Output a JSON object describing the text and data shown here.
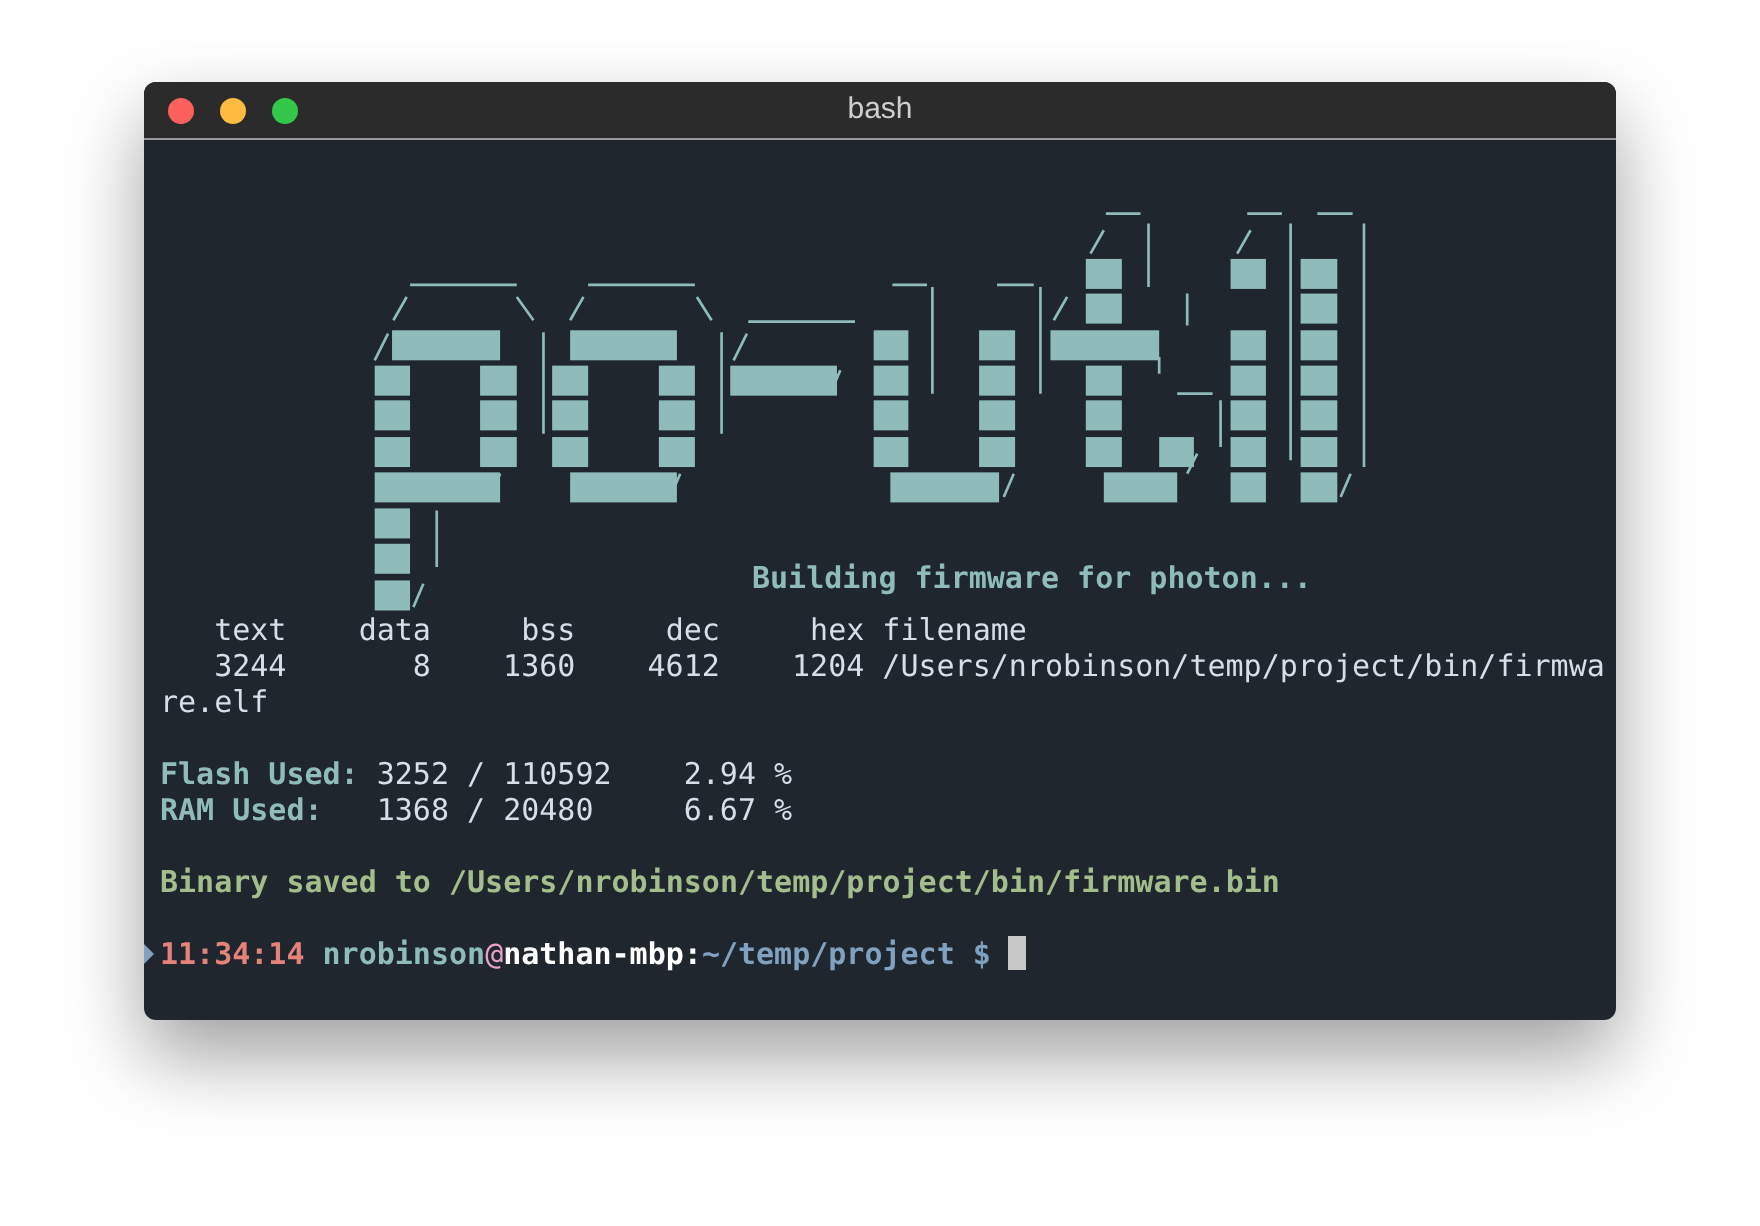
{
  "window": {
    "title": "bash"
  },
  "build_message": "Building firmware for photon...",
  "size_table": {
    "columns": [
      "text",
      "data",
      "bss",
      "dec",
      "hex",
      "filename"
    ],
    "rows": [
      [
        "3244",
        "8",
        "1360",
        "4612",
        "1204",
        "/Users/nrobinson/temp/project/bin/firmware.elf"
      ]
    ]
  },
  "memory": [
    {
      "label": "Flash Used:",
      "usage": "3252 / 110592",
      "percent": "2.94 %"
    },
    {
      "label": "RAM Used:",
      "usage": "1368 / 20480",
      "percent": "6.67 %"
    }
  ],
  "binary_message": "Binary saved to /Users/nrobinson/temp/project/bin/firmware.bin",
  "prompt": {
    "time": "11:34:14",
    "user": "nrobinson",
    "at": "@",
    "host": "nathan-mbp",
    "separator": ":",
    "path": "~/temp/project",
    "symbol": "$"
  }
}
